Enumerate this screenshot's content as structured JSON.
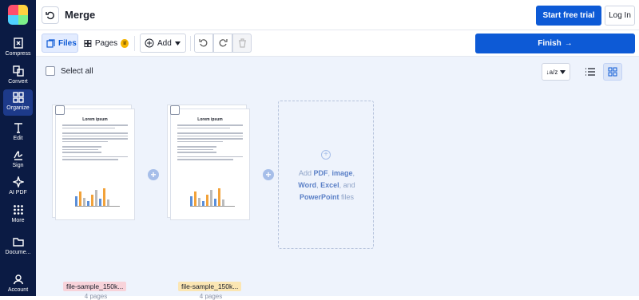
{
  "sidebar": {
    "items": [
      {
        "label": "Compress",
        "icon": "compress-icon"
      },
      {
        "label": "Convert",
        "icon": "convert-icon"
      },
      {
        "label": "Organize",
        "icon": "organize-icon"
      },
      {
        "label": "Edit",
        "icon": "edit-icon"
      },
      {
        "label": "Sign",
        "icon": "sign-icon"
      },
      {
        "label": "AI PDF",
        "icon": "ai-sparkle-icon"
      },
      {
        "label": "More",
        "icon": "grid-icon"
      },
      {
        "label": "Docume...",
        "icon": "folder-icon"
      },
      {
        "label": "Account",
        "icon": "user-icon"
      }
    ],
    "active": "Organize"
  },
  "header": {
    "title": "Merge",
    "trial_label": "Start free trial",
    "login_label": "Log In"
  },
  "toolbar": {
    "files_label": "Files",
    "pages_label": "Pages",
    "add_label": "Add",
    "finish_label": "Finish"
  },
  "main": {
    "select_all_label": "Select all",
    "sort_label": "↓a/z"
  },
  "files": [
    {
      "name": "file-sample_150k...",
      "pages": "4 pages",
      "doc_title": "Lorem ipsum"
    },
    {
      "name": "file-sample_150k...",
      "pages": "4 pages",
      "doc_title": "Lorem ipsum"
    }
  ],
  "dropzone": {
    "prefix": "Add ",
    "pdf": "PDF",
    "comma1": ", ",
    "image": "image",
    "comma2": ",",
    "word": "Word",
    "comma3": ", ",
    "excel": "Excel",
    "and": ", and",
    "ppt": "PowerPoint",
    "suffix": " files"
  },
  "colors": {
    "sidebar": "#0b1b44",
    "accent": "#0d5ad6",
    "file1_tag": "#f8d3da",
    "file2_tag": "#fbe6b3",
    "crown": "#f6b500"
  }
}
